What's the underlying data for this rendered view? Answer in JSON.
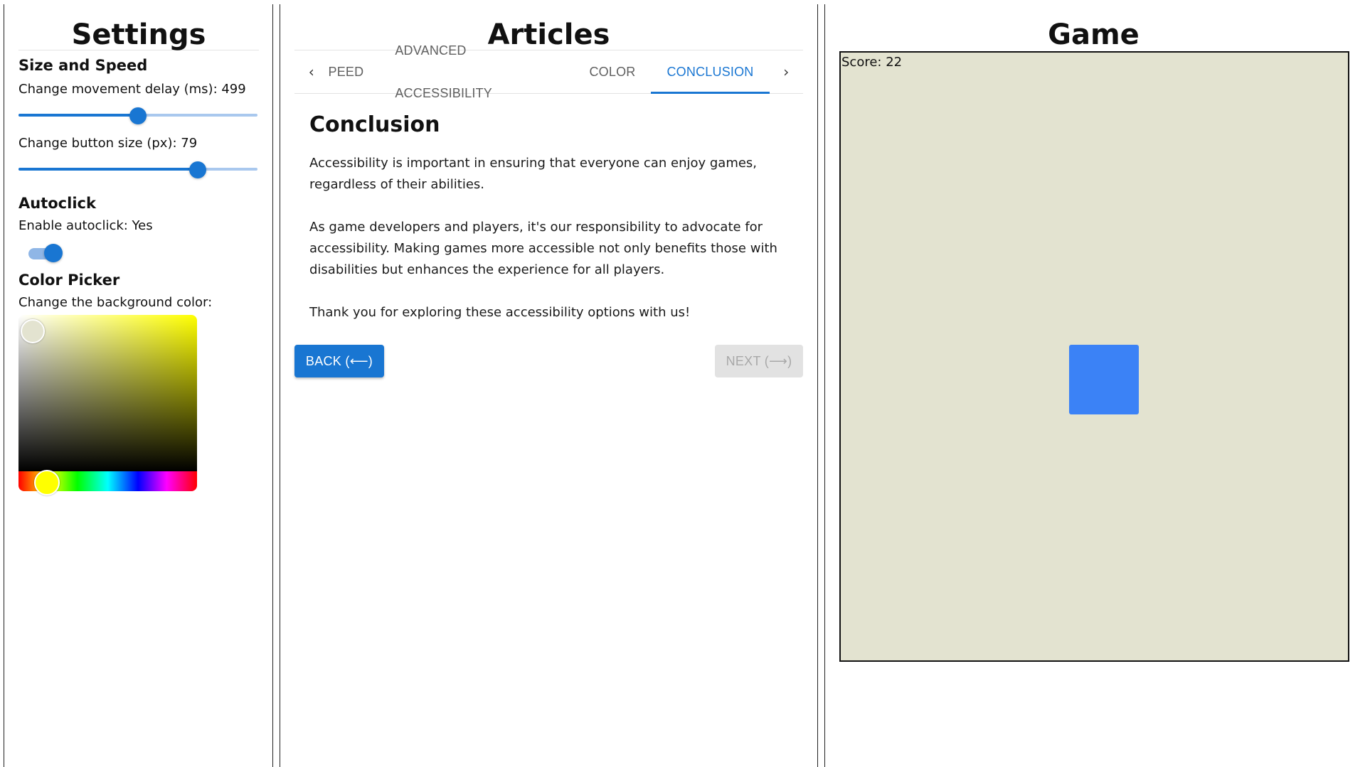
{
  "settings": {
    "title": "Settings",
    "size_speed": {
      "heading": "Size and Speed",
      "delay_label": "Change movement delay (ms): 499",
      "delay_value": 499,
      "delay_fraction": 0.5,
      "size_label": "Change button size (px): 79",
      "size_value": 79,
      "size_fraction": 0.75
    },
    "autoclick": {
      "heading": "Autoclick",
      "label": "Enable autoclick: Yes",
      "enabled": true
    },
    "color_picker": {
      "heading": "Color Picker",
      "label": "Change the background color:",
      "selected_color": "#e3e3d0",
      "hue_color": "#ffff00"
    }
  },
  "articles": {
    "title": "Articles",
    "tabs": [
      {
        "label": "PEED",
        "active": false
      },
      {
        "label": "ADVANCED ACCESSIBILITY",
        "active": false
      },
      {
        "label": "COLOR",
        "active": false
      },
      {
        "label": "CONCLUSION",
        "active": true
      }
    ],
    "tab_scroll_left": "‹",
    "tab_scroll_right": "›",
    "article": {
      "heading": "Conclusion",
      "paragraphs": [
        "Accessibility is important in ensuring that everyone can enjoy games, regardless of their abilities.",
        "As game developers and players, it's our responsibility to advocate for accessibility. Making games more accessible not only benefits those with disabilities but enhances the experience for all players.",
        "Thank you for exploring these accessibility options with us!"
      ]
    },
    "back_label": "BACK (⟵)",
    "next_label": "NEXT (⟶)",
    "next_disabled": true
  },
  "game": {
    "title": "Game",
    "score_text": "Score: 22",
    "background_color": "#e3e3d0",
    "target_color": "#3b82f6"
  },
  "colors": {
    "accent": "#1976d2",
    "disabled_bg": "#e2e2e2",
    "disabled_text": "#a8a8a8"
  }
}
